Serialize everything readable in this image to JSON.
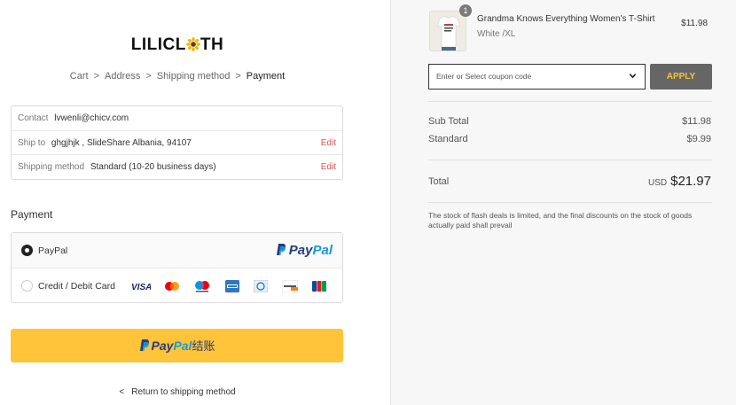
{
  "brand": {
    "logo_text_left": "LILICL",
    "logo_text_right": "TH"
  },
  "breadcrumb": {
    "items": [
      "Cart",
      "Address",
      "Shipping method"
    ],
    "current": "Payment",
    "separator": ">"
  },
  "info": {
    "contact_label": "Contact",
    "contact_value": "lvwenli@chicv.com",
    "shipto_label": "Ship to",
    "shipto_value": "ghgjhjk , SlideShare Albania, 94107",
    "shipping_label": "Shipping method",
    "shipping_value": "Standard (10-20 business days)",
    "edit_label": "Edit"
  },
  "payment": {
    "title": "Payment",
    "option_paypal": "PayPal",
    "option_card": "Credit / Debit Card",
    "paypal_logo_a": "Pay",
    "paypal_logo_b": "Pal",
    "selected": "PayPal"
  },
  "paypal_button": {
    "label_a": "Pay",
    "label_b": "Pal",
    "label_cn": "结账"
  },
  "return_link": {
    "label": "Return to shipping method"
  },
  "order": {
    "quantity": "1",
    "product_name": "Grandma Knows Everything Women's T-Shirt",
    "variant": "White /XL",
    "price": "$11.98"
  },
  "coupon": {
    "placeholder": "Enter or Select coupon code",
    "apply_label": "APPLY"
  },
  "summary": {
    "subtotal_label": "Sub Total",
    "subtotal_value": "$11.98",
    "shipping_label": "Standard",
    "shipping_value": "$9.99",
    "total_label": "Total",
    "total_currency": "USD",
    "total_value": "$21.97",
    "notice": "The stock of flash deals is limited, and the final discounts on the stock of goods actually paid shall prevail"
  },
  "colors": {
    "paypal_yellow": "#ffc439",
    "paypal_dark_blue": "#253b80",
    "paypal_light_blue": "#179bd7",
    "edit_red": "#e25555",
    "apply_bg": "#666666",
    "apply_text": "#f3c33c"
  }
}
